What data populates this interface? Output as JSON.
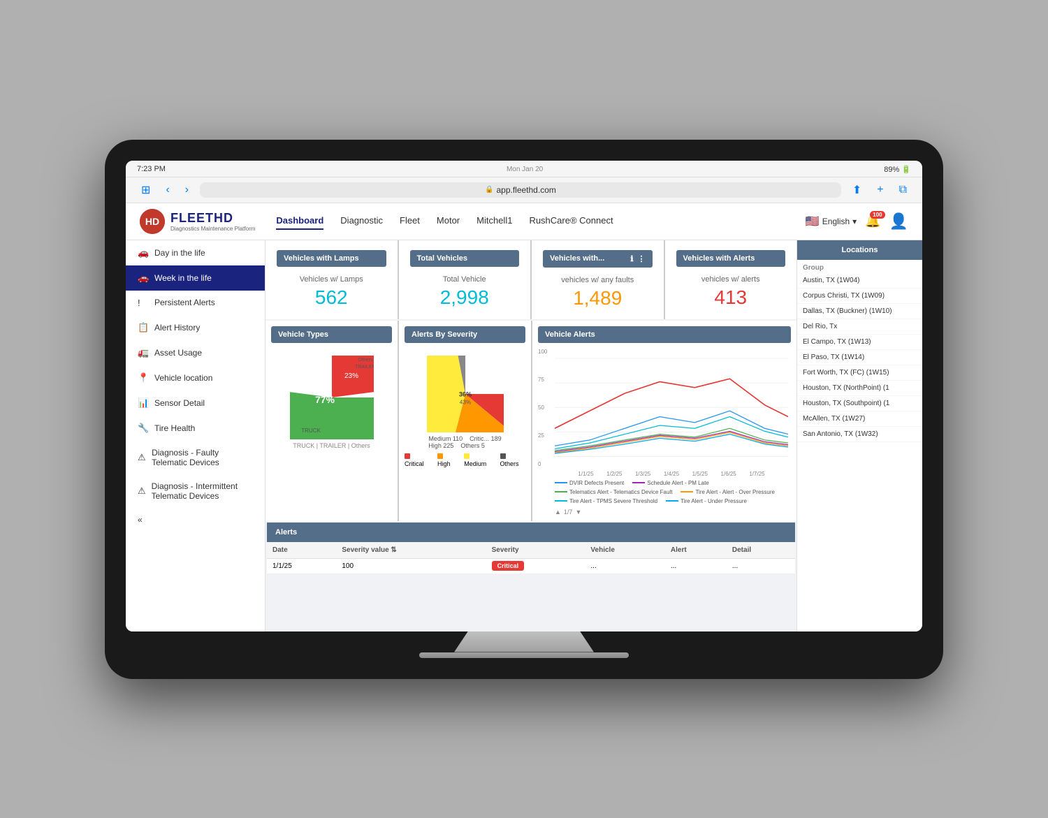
{
  "device": {
    "time": "7:23 PM",
    "day": "Mon Jan 20",
    "battery": "89%",
    "url": "app.fleethd.com"
  },
  "app": {
    "logo_text": "FLEETHD",
    "logo_subtitle": "Diagnostics Maintenance Platform",
    "logo_icon": "H"
  },
  "nav": {
    "items": [
      {
        "label": "Dashboard",
        "active": true
      },
      {
        "label": "Diagnostic",
        "active": false
      },
      {
        "label": "Fleet",
        "active": false
      },
      {
        "label": "Motor",
        "active": false
      },
      {
        "label": "Mitchell1",
        "active": false
      },
      {
        "label": "RushCare® Connect",
        "active": false
      }
    ]
  },
  "header_right": {
    "language": "English",
    "notification_count": "100"
  },
  "sidebar": {
    "items": [
      {
        "icon": "🚗",
        "label": "Day in the life"
      },
      {
        "icon": "🚗",
        "label": "Week in the life",
        "active": true
      },
      {
        "icon": "!",
        "label": "Persistent Alerts"
      },
      {
        "icon": "📋",
        "label": "Alert History"
      },
      {
        "icon": "🚛",
        "label": "Asset Usage"
      },
      {
        "icon": "📍",
        "label": "Vehicle location"
      },
      {
        "icon": "📊",
        "label": "Sensor Detail"
      },
      {
        "icon": "🔧",
        "label": "Tire Health"
      },
      {
        "icon": "⚠",
        "label": "Diagnosis - Faulty Telematic Devices"
      },
      {
        "icon": "⚠",
        "label": "Diagnosis - Intermittent Telematic Devices"
      },
      {
        "icon": "«",
        "label": ""
      }
    ]
  },
  "stats": [
    {
      "header": "Vehicles with Lamps",
      "label": "Vehicles w/ Lamps",
      "value": "562",
      "color": "cyan"
    },
    {
      "header": "Total Vehicles",
      "label": "Total Vehicle",
      "value": "2,998",
      "color": "cyan"
    },
    {
      "header": "Vehicles with...",
      "label": "vehicles w/ any faults",
      "value": "1,489",
      "color": "orange"
    },
    {
      "header": "Vehicles with Alerts",
      "label": "vehicles w/ alerts",
      "value": "413",
      "color": "red"
    }
  ],
  "vehicle_types_chart": {
    "header": "Vehicle Types",
    "truck_pct": "77%",
    "trailer_pct": "23%",
    "truck_label": "TRUCK",
    "trailer_label": "TRAILER",
    "others_label": "Others"
  },
  "alerts_severity_chart": {
    "header": "Alerts By Severity",
    "others_label": "Others",
    "others_value": "5",
    "critical_label": "Critic...",
    "critical_value": "189",
    "high_value": "225",
    "medium_value": "110",
    "medium_label": "Medium",
    "high_label": "High",
    "pct_36": "36%",
    "pct_43": "43%",
    "legend": [
      {
        "color": "#e53935",
        "label": "Critical"
      },
      {
        "color": "#ff9800",
        "label": "High"
      },
      {
        "color": "#ffeb3b",
        "label": "Medium"
      },
      {
        "color": "#555",
        "label": "Others"
      }
    ]
  },
  "vehicle_alerts_chart": {
    "header": "Vehicle Alerts",
    "y_labels": [
      "100",
      "75",
      "50",
      "25",
      "0"
    ],
    "x_labels": [
      "1/1/25",
      "1/2/25",
      "1/3/25",
      "1/4/25",
      "1/5/25",
      "1/6/25",
      "1/7/25"
    ],
    "page_info": "1/7",
    "legend": [
      {
        "color": "#2196f3",
        "label": "DVIR Defects Present"
      },
      {
        "color": "#9c27b0",
        "label": "Schedule Alert - PM Late"
      },
      {
        "color": "#4caf50",
        "label": "Telematics Alert - Telematics Device Fault"
      },
      {
        "color": "#ff9800",
        "label": "Tire Alert - Alert - Over Pressure"
      },
      {
        "color": "#00bcd4",
        "label": "Tire Alert - TPMS Severe Threshold"
      },
      {
        "color": "#03a9f4",
        "label": "Tire Alert - Under Pressure"
      }
    ]
  },
  "alerts_table": {
    "header": "Alerts",
    "columns": [
      "Date",
      "Severity value",
      "Severity",
      "Vehicle",
      "Alert",
      "Detail"
    ],
    "rows": [
      {
        "date": "1/1/25",
        "sev_val": "100",
        "severity": "Critical",
        "vehicle": "...",
        "alert": "...",
        "detail": "..."
      }
    ]
  },
  "locations": {
    "header": "Locations",
    "group_label": "Group",
    "items": [
      "Austin, TX (1W04)",
      "Corpus Christi, TX (1W09)",
      "Dallas, TX (Buckner) (1W10)",
      "Del Rio, Tx",
      "El Campo, TX (1W13)",
      "El Paso, TX (1W14)",
      "Fort Worth, TX (FC) (1W15)",
      "Houston, TX (NorthPoint) (1",
      "Houston, TX (Southpoint) (1",
      "McAllen, TX (1W27)",
      "San Antonio, TX (1W32)"
    ]
  }
}
